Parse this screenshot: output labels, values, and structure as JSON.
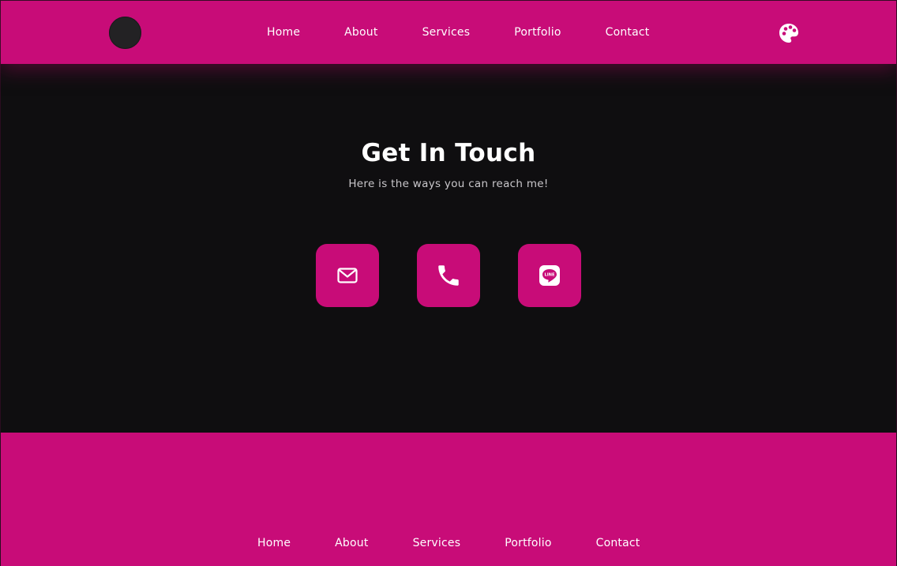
{
  "header": {
    "logo": "avatar-circle",
    "nav": [
      "Home",
      "About",
      "Services",
      "Portfolio",
      "Contact"
    ],
    "palette_icon": "palette-icon"
  },
  "main": {
    "title": "Get In Touch",
    "subtitle": "Here is the ways you can reach me!",
    "contacts": [
      {
        "icon": "email-icon"
      },
      {
        "icon": "phone-icon"
      },
      {
        "icon": "line-icon"
      }
    ]
  },
  "footer": {
    "nav": [
      "Home",
      "About",
      "Services",
      "Portfolio",
      "Contact"
    ]
  },
  "colors": {
    "accent": "#c80c78",
    "background": "#0f0e10",
    "text": "#ffffff",
    "muted_text": "#c9c7cb"
  }
}
